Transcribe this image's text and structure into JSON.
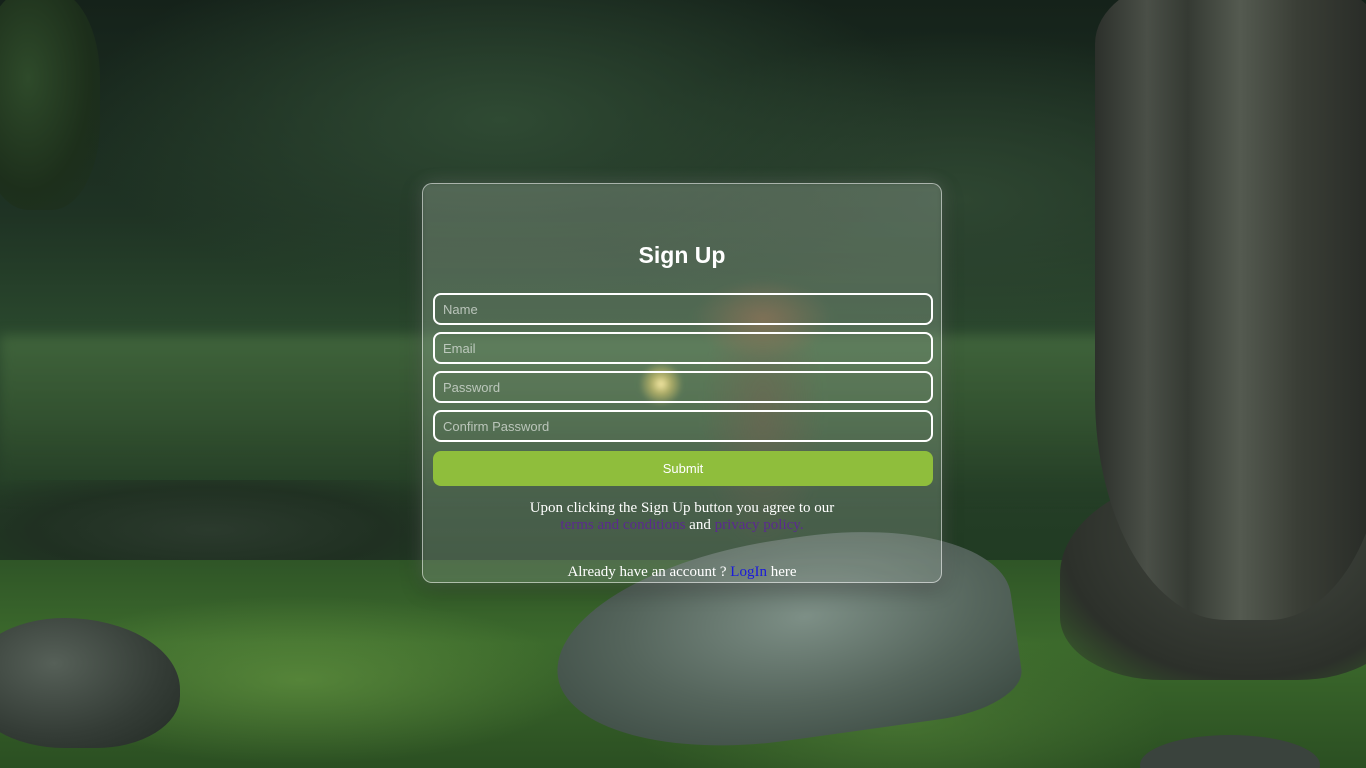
{
  "form": {
    "title": "Sign Up",
    "fields": {
      "name_placeholder": "Name",
      "email_placeholder": "Email",
      "password_placeholder": "Password",
      "confirm_placeholder": "Confirm Password"
    },
    "submit_label": "Submit",
    "terms_prefix": "Upon clicking the Sign Up button you agree to our",
    "terms_link": "terms and conditions",
    "terms_and": "and",
    "privacy_link": "privacy policy.",
    "login_prefix": "Already have an account ?",
    "login_link": "LogIn",
    "login_suffix": "here"
  },
  "colors": {
    "submit_bg": "#8fbe3c",
    "link_visited": "#5b2a8f",
    "link": "#1a1adb"
  }
}
